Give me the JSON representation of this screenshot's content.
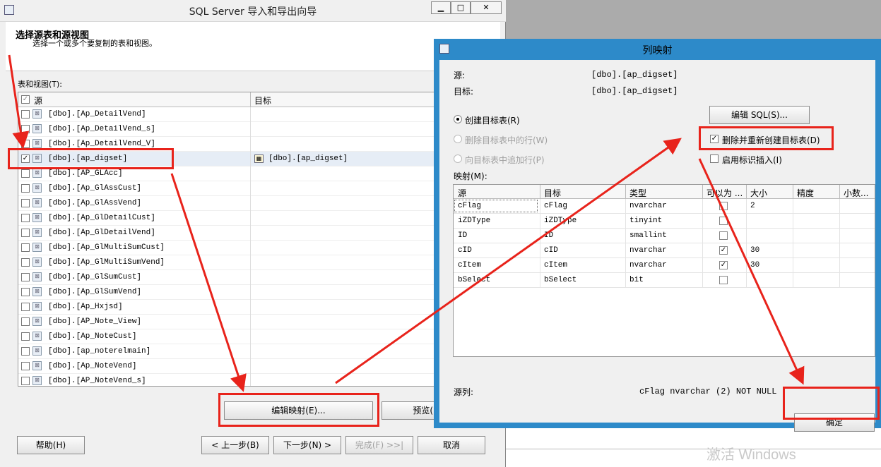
{
  "wizard": {
    "title": "SQL Server 导入和导出向导",
    "window_buttons": {
      "minimize": "▁",
      "maximize": "□",
      "close": "✕"
    },
    "header_title": "选择源表和源视图",
    "header_subtitle": "选择一个或多个要复制的表和视图。",
    "tables_label": "表和视图(T):",
    "columns": {
      "source": "源",
      "target": "目标"
    },
    "rows": [
      {
        "source": "[dbo].[Ap_DetailVend]",
        "checked": false,
        "target": ""
      },
      {
        "source": "[dbo].[Ap_DetailVend_s]",
        "checked": false,
        "target": ""
      },
      {
        "source": "[dbo].[Ap_DetailVend_V]",
        "checked": false,
        "target": ""
      },
      {
        "source": "[dbo].[ap_digset]",
        "checked": true,
        "target": "[dbo].[ap_digset]"
      },
      {
        "source": "[dbo].[AP_GLAcc]",
        "checked": false,
        "target": ""
      },
      {
        "source": "[dbo].[Ap_GlAssCust]",
        "checked": false,
        "target": ""
      },
      {
        "source": "[dbo].[Ap_GlAssVend]",
        "checked": false,
        "target": ""
      },
      {
        "source": "[dbo].[Ap_GlDetailCust]",
        "checked": false,
        "target": ""
      },
      {
        "source": "[dbo].[Ap_GlDetailVend]",
        "checked": false,
        "target": ""
      },
      {
        "source": "[dbo].[Ap_GlMultiSumCust]",
        "checked": false,
        "target": ""
      },
      {
        "source": "[dbo].[Ap_GlMultiSumVend]",
        "checked": false,
        "target": ""
      },
      {
        "source": "[dbo].[Ap_GlSumCust]",
        "checked": false,
        "target": ""
      },
      {
        "source": "[dbo].[Ap_GlSumVend]",
        "checked": false,
        "target": ""
      },
      {
        "source": "[dbo].[Ap_Hxjsd]",
        "checked": false,
        "target": ""
      },
      {
        "source": "[dbo].[AP_Note_View]",
        "checked": false,
        "target": ""
      },
      {
        "source": "[dbo].[Ap_NoteCust]",
        "checked": false,
        "target": ""
      },
      {
        "source": "[dbo].[ap_noterelmain]",
        "checked": false,
        "target": ""
      },
      {
        "source": "[dbo].[Ap_NoteVend]",
        "checked": false,
        "target": ""
      },
      {
        "source": "[dbo].[AP_NoteVend_s]",
        "checked": false,
        "target": ""
      }
    ],
    "edit_mapping_button": "编辑映射(E)...",
    "preview_button": "预览(",
    "help_button": "帮助(H)",
    "back_button": "< 上一步(B)",
    "next_button": "下一步(N) >",
    "finish_button": "完成(F) >>|",
    "cancel_button": "取消"
  },
  "dialog": {
    "title": "列映射",
    "source_label": "源:",
    "source_value": "[dbo].[ap_digset]",
    "target_label": "目标:",
    "target_value": "[dbo].[ap_digset]",
    "radio_create": "创建目标表(R)",
    "radio_delete_rows": "删除目标表中的行(W)",
    "radio_append": "向目标表中追加行(P)",
    "edit_sql_button": "编辑 SQL(S)...",
    "drop_recreate_label": "删除并重新创建目标表(D)",
    "drop_recreate_checked": true,
    "identity_insert_label": "启用标识插入(I)",
    "identity_insert_checked": false,
    "mappings_label": "映射(M):",
    "mapping_columns": [
      "源",
      "目标",
      "类型",
      "可以为 ...",
      "大小",
      "精度",
      "小数..."
    ],
    "mappings": [
      {
        "source": "cFlag",
        "target": "cFlag",
        "type": "nvarchar",
        "nullable": false,
        "size": "2",
        "precision": "",
        "scale": ""
      },
      {
        "source": "iZDType",
        "target": "iZDType",
        "type": "tinyint",
        "nullable": false,
        "size": "",
        "precision": "",
        "scale": ""
      },
      {
        "source": "ID",
        "target": "ID",
        "type": "smallint",
        "nullable": false,
        "size": "",
        "precision": "",
        "scale": ""
      },
      {
        "source": "cID",
        "target": "cID",
        "type": "nvarchar",
        "nullable": true,
        "size": "30",
        "precision": "",
        "scale": ""
      },
      {
        "source": "cItem",
        "target": "cItem",
        "type": "nvarchar",
        "nullable": true,
        "size": "30",
        "precision": "",
        "scale": ""
      },
      {
        "source": "bSelect",
        "target": "bSelect",
        "type": "bit",
        "nullable": false,
        "size": "",
        "precision": "",
        "scale": ""
      }
    ],
    "source_column_label": "源列:",
    "source_column_value": "cFlag nvarchar (2) NOT NULL",
    "ok_button": "确定"
  },
  "watermark": "激活 Windows",
  "colors": {
    "annotation_red": "#e8231b",
    "dialog_frame": "#2d8ac9",
    "window_bg": "#f0f0f0"
  }
}
